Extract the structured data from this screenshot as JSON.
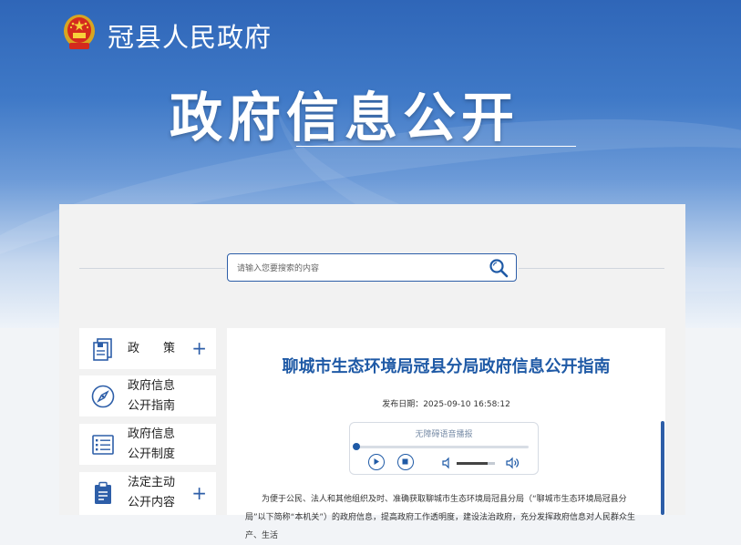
{
  "header": {
    "site_name": "冠县人民政府",
    "page_title": "政府信息公开"
  },
  "search": {
    "placeholder": "请输入您要搜索的内容"
  },
  "sidebar": {
    "items": [
      {
        "label": "政　　策",
        "icon": "document-icon",
        "expandable": true
      },
      {
        "label_line1": "政府信息",
        "label_line2": "公开指南",
        "icon": "compass-icon",
        "expandable": false
      },
      {
        "label_line1": "政府信息",
        "label_line2": "公开制度",
        "icon": "list-icon",
        "expandable": false
      },
      {
        "label_line1": "法定主动",
        "label_line2": "公开内容",
        "icon": "clipboard-icon",
        "expandable": true
      }
    ],
    "plus_symbol": "+"
  },
  "article": {
    "title": "聊城市生态环境局冠县分局政府信息公开指南",
    "publish_date": "发布日期：2025-09-10 16:58:12",
    "body": "为便于公民、法人和其他组织及时、准确获取聊城市生态环境局冠县分局（“聊城市生态环境局冠县分局”以下简称“本机关”）的政府信息，提高政府工作透明度，建设法治政府，充分发挥政府信息对人民群众生产、生活"
  },
  "audio_player": {
    "title": "无障碍语音播报",
    "progress": 0.0,
    "volume": 0.8
  },
  "colors": {
    "brand_blue": "#1f5aa6",
    "banner_blue": "#2f66b8"
  }
}
